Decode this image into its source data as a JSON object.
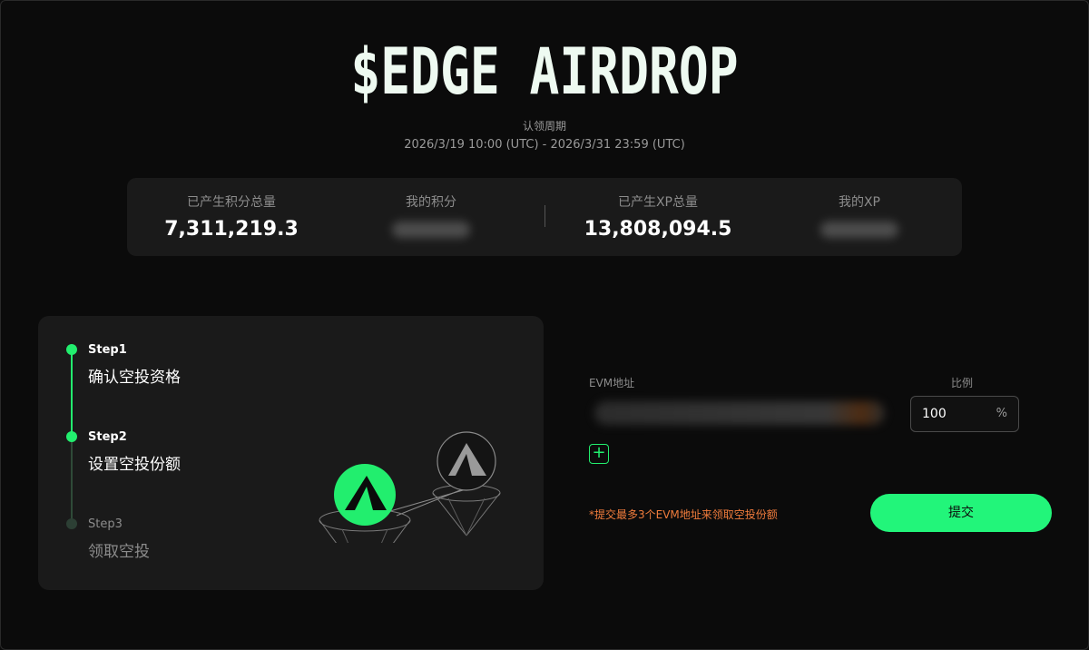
{
  "header": {
    "title": "$EDGE AIRDROP",
    "period_label": "认领周期",
    "period_range": "2026/3/19 10:00 (UTC) - 2026/3/31 23:59 (UTC)"
  },
  "stats": {
    "total_points_label": "已产生积分总量",
    "total_points_value": "7,311,219.3",
    "my_points_label": "我的积分",
    "total_xp_label": "已产生XP总量",
    "total_xp_value": "13,808,094.5",
    "my_xp_label": "我的XP"
  },
  "steps": [
    {
      "num": "Step1",
      "name": "确认空投资格"
    },
    {
      "num": "Step2",
      "name": "设置空投份额"
    },
    {
      "num": "Step3",
      "name": "领取空投"
    }
  ],
  "form": {
    "evm_label": "EVM地址",
    "ratio_label": "比例",
    "ratio_value": "100",
    "ratio_unit": "%",
    "add_symbol": "+",
    "notice": "*提交最多3个EVM地址来领取空投份额",
    "submit_label": "提交"
  },
  "colors": {
    "accent": "#22ee6e",
    "notice": "#f07c3c",
    "background": "#0b0b0b",
    "card": "#1a1a1a"
  },
  "icons": [
    "edge-logo-icon",
    "plus-icon"
  ]
}
